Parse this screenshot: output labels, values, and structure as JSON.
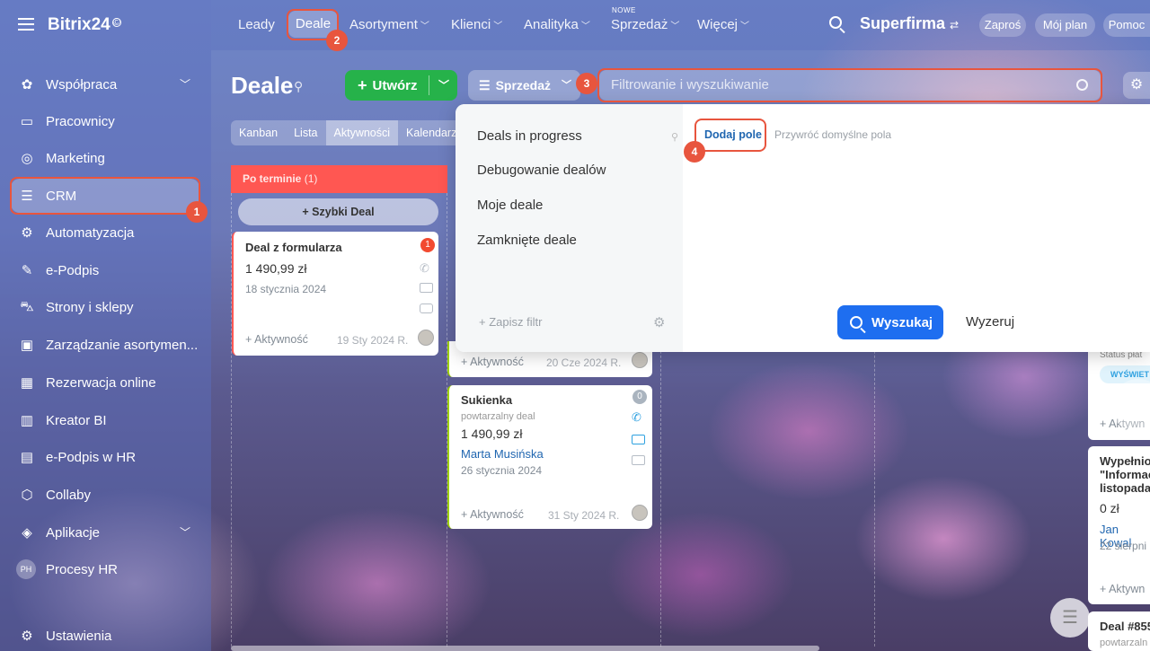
{
  "app": {
    "brand": "Bitrix24",
    "brand_mark": "©"
  },
  "sidebar": {
    "items": [
      {
        "label": "Współpraca",
        "icon": "chat-bubbles-icon",
        "chevron": true
      },
      {
        "label": "Pracownicy",
        "icon": "id-card-icon"
      },
      {
        "label": "Marketing",
        "icon": "target-icon"
      },
      {
        "label": "CRM",
        "icon": "funnel-icon",
        "active": true
      },
      {
        "label": "Automatyzacja",
        "icon": "robot-icon"
      },
      {
        "label": "e-Podpis",
        "icon": "pen-icon"
      },
      {
        "label": "Strony i sklepy",
        "icon": "cart-icon"
      },
      {
        "label": "Zarządzanie asortymen...",
        "icon": "box-icon"
      },
      {
        "label": "Rezerwacja online",
        "icon": "calendar-icon"
      },
      {
        "label": "Kreator BI",
        "icon": "bar-chart-icon"
      },
      {
        "label": "e-Podpis w HR",
        "icon": "document-sign-icon"
      },
      {
        "label": "Collaby",
        "icon": "hexagon-icon"
      },
      {
        "label": "Aplikacje",
        "icon": "cube-icon",
        "chevron": true
      },
      {
        "label": "Procesy HR",
        "icon": "avatar-ph-icon",
        "initials": "PH"
      }
    ],
    "settings_label": "Ustawienia"
  },
  "topnav": {
    "links": [
      "Leady",
      "Deale",
      "Asortyment",
      "Klienci",
      "Analityka",
      "Sprzedaż",
      "Więcej"
    ],
    "new_badge": "NOWE",
    "company": "Superfirma",
    "invite": "Zaproś",
    "my_plan": "Mój plan",
    "help": "Pomoc"
  },
  "page": {
    "title": "Deale",
    "create_label": "Utwórz",
    "pipeline_label": "Sprzedaż",
    "filter_placeholder": "Filtrowanie i wyszukiwanie",
    "view_tabs": [
      "Kanban",
      "Lista",
      "Aktywności",
      "Kalendarz"
    ]
  },
  "kanban": {
    "column1": {
      "title": "Po terminie",
      "count": "(1)",
      "quick_deal": "Szybki Deal"
    },
    "card1": {
      "title": "Deal z formularza",
      "price": "1 490,99 zł",
      "date": "18 stycznia 2024",
      "activity": "+ Aktywność",
      "due": "19 Sty 2024 R.",
      "badge": "1"
    },
    "card_partial": {
      "activity": "+ Aktywność",
      "due": "20 Cze 2024 R."
    },
    "card2": {
      "title": "Sukienka",
      "subtitle": "powtarzalny deal",
      "price": "1 490,99 zł",
      "person": "Marta Musińska",
      "date": "26 stycznia 2024",
      "activity": "+ Aktywność",
      "due": "31 Sty 2024 R.",
      "badge": "0"
    },
    "right_cards": {
      "status_label": "Status płat",
      "status_btn": "WYŚWIET",
      "activity1": "+ Aktywn",
      "title2_l1": "Wypełnio",
      "title2_l2": "\"Informac",
      "title2_l3": "listopada'",
      "price2": "0 zł",
      "person2": "Jan Kowal",
      "date2": "22 sierpni",
      "activity2": "+ Aktywn",
      "title3": "Deal #855",
      "subtitle3": "powtarzaln"
    }
  },
  "filter_panel": {
    "presets": [
      "Deals in progress",
      "Debugowanie dealów",
      "Moje deale",
      "Zamknięte deale"
    ],
    "save_filter": "Zapisz filtr",
    "add_field": "Dodaj pole",
    "restore_defaults": "Przywróć domyślne pola",
    "search_btn": "Wyszukaj",
    "reset_btn": "Wyzeruj"
  },
  "annotations": [
    "1",
    "2",
    "3",
    "4"
  ],
  "colors": {
    "accent_green": "#26b24a",
    "overdue_red": "#ff5752",
    "search_blue": "#1e6ef0",
    "annotation_red": "#e8553e"
  }
}
